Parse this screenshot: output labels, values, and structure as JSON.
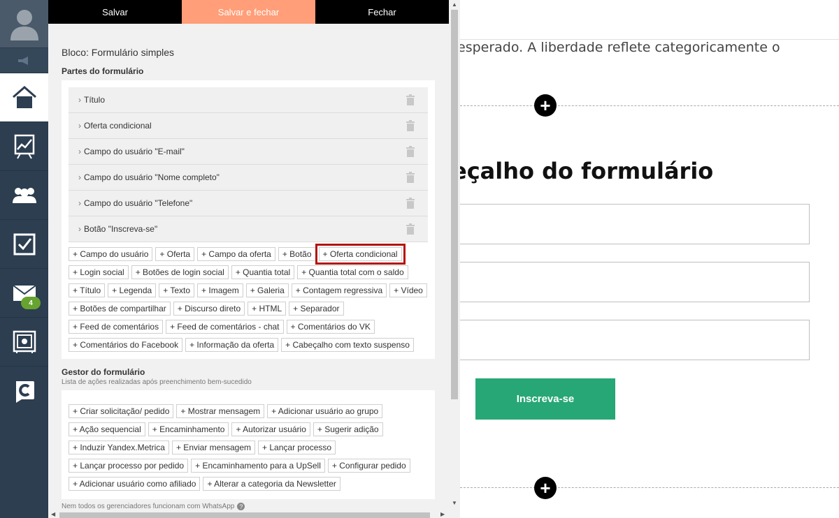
{
  "toolbar": {
    "save_label": "Salvar",
    "save_close_label": "Salvar e fechar",
    "close_label": "Fechar"
  },
  "sidebar": {
    "notification_count": "4",
    "items": [
      {
        "name": "home",
        "icon": "home-icon"
      },
      {
        "name": "stats",
        "icon": "chart-icon"
      },
      {
        "name": "users",
        "icon": "users-icon"
      },
      {
        "name": "tasks",
        "icon": "checkbox-icon"
      },
      {
        "name": "messages",
        "icon": "mail-icon"
      },
      {
        "name": "safe",
        "icon": "safe-icon"
      },
      {
        "name": "brand",
        "icon": "logo-icon"
      }
    ]
  },
  "panel": {
    "block_title": "Bloco: Formulário simples",
    "parts_title": "Partes do formulário",
    "parts": [
      "Título",
      "Oferta condicional",
      "Campo do usuário \"E-mail\"",
      "Campo do usuário \"Nome completo\"",
      "Campo do usuário \"Telefone\"",
      "Botão \"Inscreva-se\""
    ],
    "add_parts": [
      "+ Campo do usuário",
      "+ Oferta",
      "+ Campo da oferta",
      "+ Botão",
      "+ Oferta condicional",
      "+ Login social",
      "+ Botões de login social",
      "+ Quantia total",
      "+ Quantia total com o saldo",
      "+ Título",
      "+ Legenda",
      "+ Texto",
      "+ Imagem",
      "+ Galeria",
      "+ Contagem regressiva",
      "+ Vídeo",
      "+ Botões de compartilhar",
      "+ Discurso direto",
      "+ HTML",
      "+ Separador",
      "+ Feed de comentários",
      "+ Feed de comentários - chat",
      "+ Comentários do VK",
      "+ Comentários do Facebook",
      "+ Informação da oferta",
      "+ Cabeçalho com texto suspenso"
    ],
    "manager_title": "Gestor do formulário",
    "manager_sub": "Lista de ações realizadas após preenchimento bem-sucedido",
    "actions": [
      "+ Criar solicitação/ pedido",
      "+ Mostrar mensagem",
      "+ Adicionar usuário ao grupo",
      "+ Ação sequencial",
      "+ Encaminhamento",
      "+ Autorizar usuário",
      "+ Sugerir adição",
      "+ Induzir Yandex.Metrica",
      "+ Enviar mensagem",
      "+ Lançar processo",
      "+ Lançar processo por pedido",
      "+ Encaminhamento para a UpSell",
      "+ Configurar pedido",
      "+ Adicionar usuário como afiliado",
      "+ Alterar a categoria da Newsletter"
    ],
    "footnote": "Nem todos os gerenciadores funcionam com WhatsApp"
  },
  "preview": {
    "paragraph": "esperado. A liberdade reflete categoricamente o",
    "form_heading": "eçalho do formulário",
    "button_label": "Inscreva-se"
  },
  "colors": {
    "sidebar_bg": "#2c3e50",
    "accent_save_close": "#ff9e78",
    "highlight_outline": "#b5140c",
    "subscribe_button": "#27a776",
    "badge": "#67a32f"
  }
}
